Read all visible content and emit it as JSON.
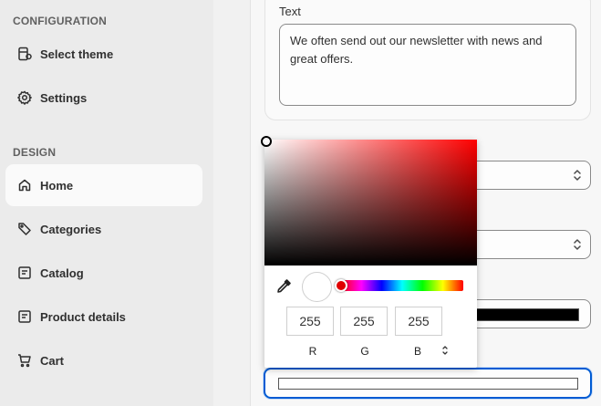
{
  "sidebar": {
    "sections": [
      {
        "title": "CONFIGURATION"
      },
      {
        "title": "DESIGN"
      }
    ],
    "items": [
      {
        "label": "Select theme",
        "icon": "theme-icon"
      },
      {
        "label": "Settings",
        "icon": "gear-icon"
      },
      {
        "label": "Home",
        "icon": "home-icon",
        "active": true
      },
      {
        "label": "Categories",
        "icon": "tag-icon"
      },
      {
        "label": "Catalog",
        "icon": "catalog-icon"
      },
      {
        "label": "Product details",
        "icon": "product-details-icon"
      },
      {
        "label": "Cart",
        "icon": "cart-icon"
      }
    ]
  },
  "form": {
    "text_label": "Text",
    "text_value": "We often send out our newsletter with news and great offers.",
    "color_value": "#000000",
    "focused_color_value": "#ffffff"
  },
  "picker": {
    "hue_color": "#ff0000",
    "r": "255",
    "g": "255",
    "b": "255",
    "r_label": "R",
    "g_label": "G",
    "b_label": "B"
  },
  "colors": {
    "focus_border": "#005bd3",
    "active_item_bg": "#fafafa",
    "sidebar_bg": "#ebebeb"
  }
}
